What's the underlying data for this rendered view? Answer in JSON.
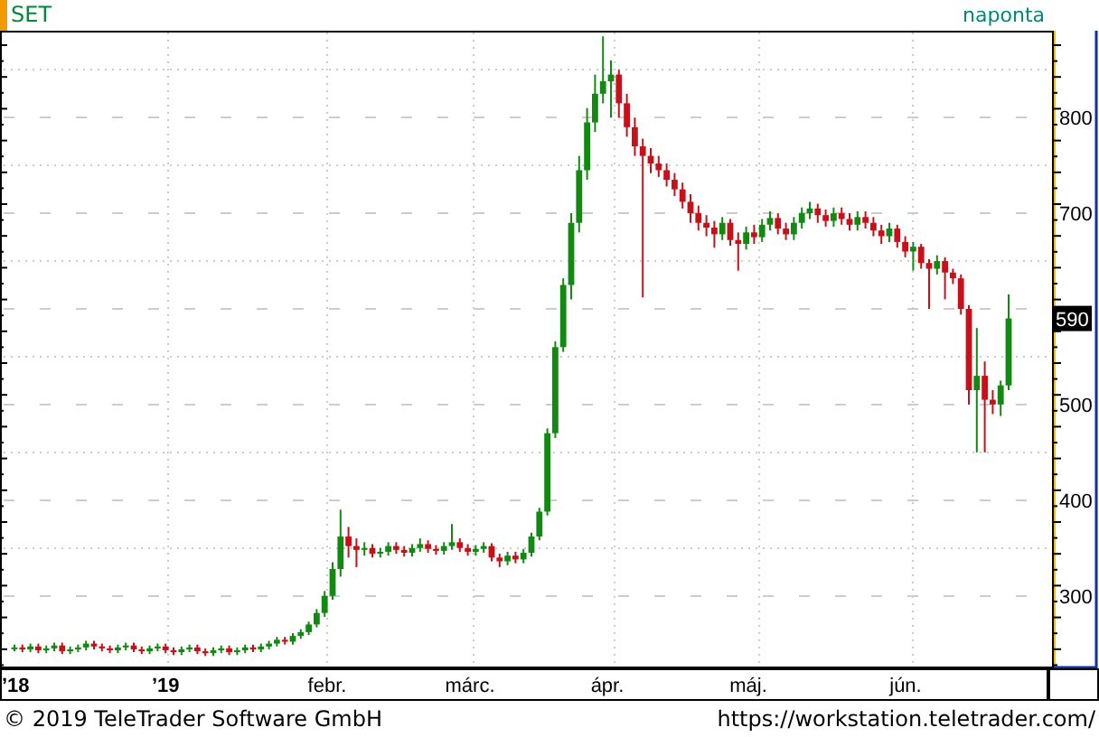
{
  "instrument": "SET",
  "interval": "naponta",
  "price_axis": {
    "last_price": "590"
  },
  "time_axis": {
    "labels": [
      {
        "text": "’18",
        "kind": "year"
      },
      {
        "text": "’19",
        "kind": "year"
      },
      {
        "text": "febr.",
        "kind": "month"
      },
      {
        "text": "márc.",
        "kind": "month"
      },
      {
        "text": "ápr.",
        "kind": "month"
      },
      {
        "text": "máj.",
        "kind": "month"
      },
      {
        "text": "jún.",
        "kind": "month"
      }
    ]
  },
  "chart_data": {
    "type": "candlestick",
    "yticks": [
      300,
      400,
      500,
      700,
      800
    ],
    "ylim": [
      226,
      889
    ],
    "grid": true,
    "categories": [
      null,
      null,
      null,
      null,
      null,
      null,
      null,
      null,
      null,
      null,
      null,
      null,
      null,
      null,
      null,
      null,
      null,
      null,
      null,
      null,
      null,
      null,
      null,
      null,
      null,
      null,
      null,
      null,
      null,
      null,
      null,
      null,
      null,
      null,
      null,
      null,
      null,
      null,
      null,
      null,
      null,
      null,
      null,
      null,
      null,
      null,
      null,
      null,
      null,
      null,
      null,
      null,
      null,
      null,
      null,
      null,
      null,
      null,
      null,
      null,
      null,
      null,
      null,
      null,
      null,
      null,
      null,
      null,
      null,
      null,
      null,
      null,
      null,
      null,
      null,
      null,
      null,
      null,
      null,
      null,
      null,
      null,
      null,
      null,
      null,
      null,
      null,
      null,
      null,
      null,
      null,
      null,
      null,
      null,
      null,
      null,
      null,
      null,
      null,
      null,
      null,
      null,
      null,
      null,
      null,
      null,
      null,
      null,
      null,
      null,
      null,
      null,
      null,
      null,
      null,
      null,
      null,
      null,
      null,
      null,
      null,
      null,
      null,
      null,
      null,
      null
    ],
    "ohlc": [
      [
        245,
        249,
        242,
        246
      ],
      [
        246,
        249,
        241,
        244
      ],
      [
        244,
        250,
        241,
        247
      ],
      [
        247,
        250,
        240,
        243
      ],
      [
        243,
        248,
        240,
        245
      ],
      [
        245,
        251,
        242,
        248
      ],
      [
        248,
        251,
        239,
        242
      ],
      [
        242,
        247,
        239,
        244
      ],
      [
        244,
        249,
        241,
        246
      ],
      [
        246,
        253,
        243,
        250
      ],
      [
        250,
        253,
        244,
        247
      ],
      [
        247,
        250,
        242,
        245
      ],
      [
        245,
        248,
        240,
        243
      ],
      [
        243,
        249,
        240,
        246
      ],
      [
        246,
        251,
        243,
        248
      ],
      [
        248,
        251,
        241,
        244
      ],
      [
        244,
        247,
        239,
        242
      ],
      [
        242,
        248,
        239,
        245
      ],
      [
        245,
        250,
        242,
        247
      ],
      [
        247,
        250,
        240,
        243
      ],
      [
        243,
        246,
        238,
        241
      ],
      [
        241,
        247,
        238,
        244
      ],
      [
        244,
        249,
        241,
        246
      ],
      [
        246,
        249,
        239,
        242
      ],
      [
        242,
        245,
        237,
        240
      ],
      [
        240,
        246,
        237,
        243
      ],
      [
        243,
        248,
        240,
        245
      ],
      [
        245,
        248,
        238,
        241
      ],
      [
        241,
        246,
        238,
        243
      ],
      [
        243,
        249,
        240,
        246
      ],
      [
        246,
        249,
        241,
        244
      ],
      [
        244,
        250,
        241,
        247
      ],
      [
        247,
        253,
        244,
        250
      ],
      [
        250,
        257,
        247,
        254
      ],
      [
        254,
        257,
        249,
        252
      ],
      [
        252,
        261,
        249,
        258
      ],
      [
        258,
        265,
        255,
        262
      ],
      [
        262,
        273,
        259,
        270
      ],
      [
        270,
        286,
        267,
        282
      ],
      [
        282,
        305,
        278,
        300
      ],
      [
        300,
        335,
        296,
        328
      ],
      [
        328,
        390,
        320,
        362
      ],
      [
        362,
        372,
        340,
        352
      ],
      [
        352,
        360,
        330,
        348
      ],
      [
        348,
        356,
        342,
        350
      ],
      [
        350,
        354,
        340,
        344
      ],
      [
        344,
        350,
        340,
        346
      ],
      [
        346,
        356,
        342,
        352
      ],
      [
        352,
        356,
        344,
        348
      ],
      [
        348,
        352,
        341,
        345
      ],
      [
        345,
        354,
        341,
        350
      ],
      [
        350,
        360,
        346,
        354
      ],
      [
        354,
        358,
        345,
        349
      ],
      [
        349,
        353,
        343,
        347
      ],
      [
        347,
        356,
        343,
        352
      ],
      [
        352,
        375,
        348,
        356
      ],
      [
        356,
        360,
        346,
        350
      ],
      [
        350,
        354,
        342,
        346
      ],
      [
        346,
        353,
        342,
        349
      ],
      [
        349,
        356,
        345,
        352
      ],
      [
        352,
        355,
        336,
        340
      ],
      [
        340,
        344,
        330,
        336
      ],
      [
        336,
        346,
        332,
        342
      ],
      [
        342,
        346,
        334,
        338
      ],
      [
        338,
        349,
        334,
        345
      ],
      [
        345,
        366,
        341,
        362
      ],
      [
        362,
        392,
        358,
        388
      ],
      [
        388,
        475,
        384,
        470
      ],
      [
        470,
        566,
        465,
        560
      ],
      [
        560,
        632,
        555,
        625
      ],
      [
        625,
        700,
        610,
        690
      ],
      [
        690,
        760,
        680,
        745
      ],
      [
        745,
        810,
        735,
        795
      ],
      [
        795,
        845,
        785,
        825
      ],
      [
        825,
        885,
        815,
        838
      ],
      [
        838,
        860,
        800,
        845
      ],
      [
        845,
        850,
        800,
        815
      ],
      [
        815,
        825,
        780,
        790
      ],
      [
        790,
        800,
        760,
        770
      ],
      [
        770,
        778,
        612,
        760
      ],
      [
        760,
        768,
        742,
        752
      ],
      [
        752,
        760,
        738,
        745
      ],
      [
        745,
        752,
        728,
        735
      ],
      [
        735,
        742,
        718,
        725
      ],
      [
        725,
        732,
        705,
        712
      ],
      [
        712,
        720,
        690,
        700
      ],
      [
        700,
        708,
        682,
        690
      ],
      [
        690,
        698,
        676,
        685
      ],
      [
        685,
        692,
        664,
        678
      ],
      [
        678,
        696,
        672,
        690
      ],
      [
        690,
        694,
        666,
        672
      ],
      [
        672,
        680,
        640,
        668
      ],
      [
        668,
        686,
        662,
        680
      ],
      [
        680,
        688,
        668,
        675
      ],
      [
        675,
        694,
        670,
        688
      ],
      [
        688,
        702,
        682,
        695
      ],
      [
        695,
        700,
        678,
        684
      ],
      [
        684,
        690,
        672,
        678
      ],
      [
        678,
        696,
        672,
        690
      ],
      [
        690,
        706,
        684,
        700
      ],
      [
        700,
        712,
        694,
        705
      ],
      [
        705,
        710,
        690,
        698
      ],
      [
        698,
        704,
        686,
        692
      ],
      [
        692,
        706,
        686,
        700
      ],
      [
        700,
        706,
        688,
        694
      ],
      [
        694,
        700,
        682,
        688
      ],
      [
        688,
        702,
        682,
        696
      ],
      [
        696,
        702,
        684,
        690
      ],
      [
        690,
        696,
        676,
        682
      ],
      [
        682,
        688,
        668,
        676
      ],
      [
        676,
        690,
        670,
        684
      ],
      [
        684,
        688,
        664,
        670
      ],
      [
        670,
        676,
        654,
        660
      ],
      [
        660,
        670,
        640,
        665
      ],
      [
        665,
        668,
        642,
        648
      ],
      [
        648,
        652,
        600,
        642
      ],
      [
        642,
        656,
        636,
        650
      ],
      [
        650,
        654,
        610,
        638
      ],
      [
        638,
        642,
        626,
        632
      ],
      [
        632,
        636,
        594,
        600
      ],
      [
        600,
        604,
        500,
        515
      ],
      [
        515,
        580,
        450,
        530
      ],
      [
        530,
        545,
        450,
        505
      ],
      [
        505,
        515,
        490,
        500
      ],
      [
        500,
        525,
        488,
        520
      ],
      [
        520,
        615,
        515,
        590
      ]
    ]
  },
  "footer": {
    "copyright": "© 2019 TeleTrader Software GmbH",
    "url": "https://workstation.teletrader.com/"
  }
}
